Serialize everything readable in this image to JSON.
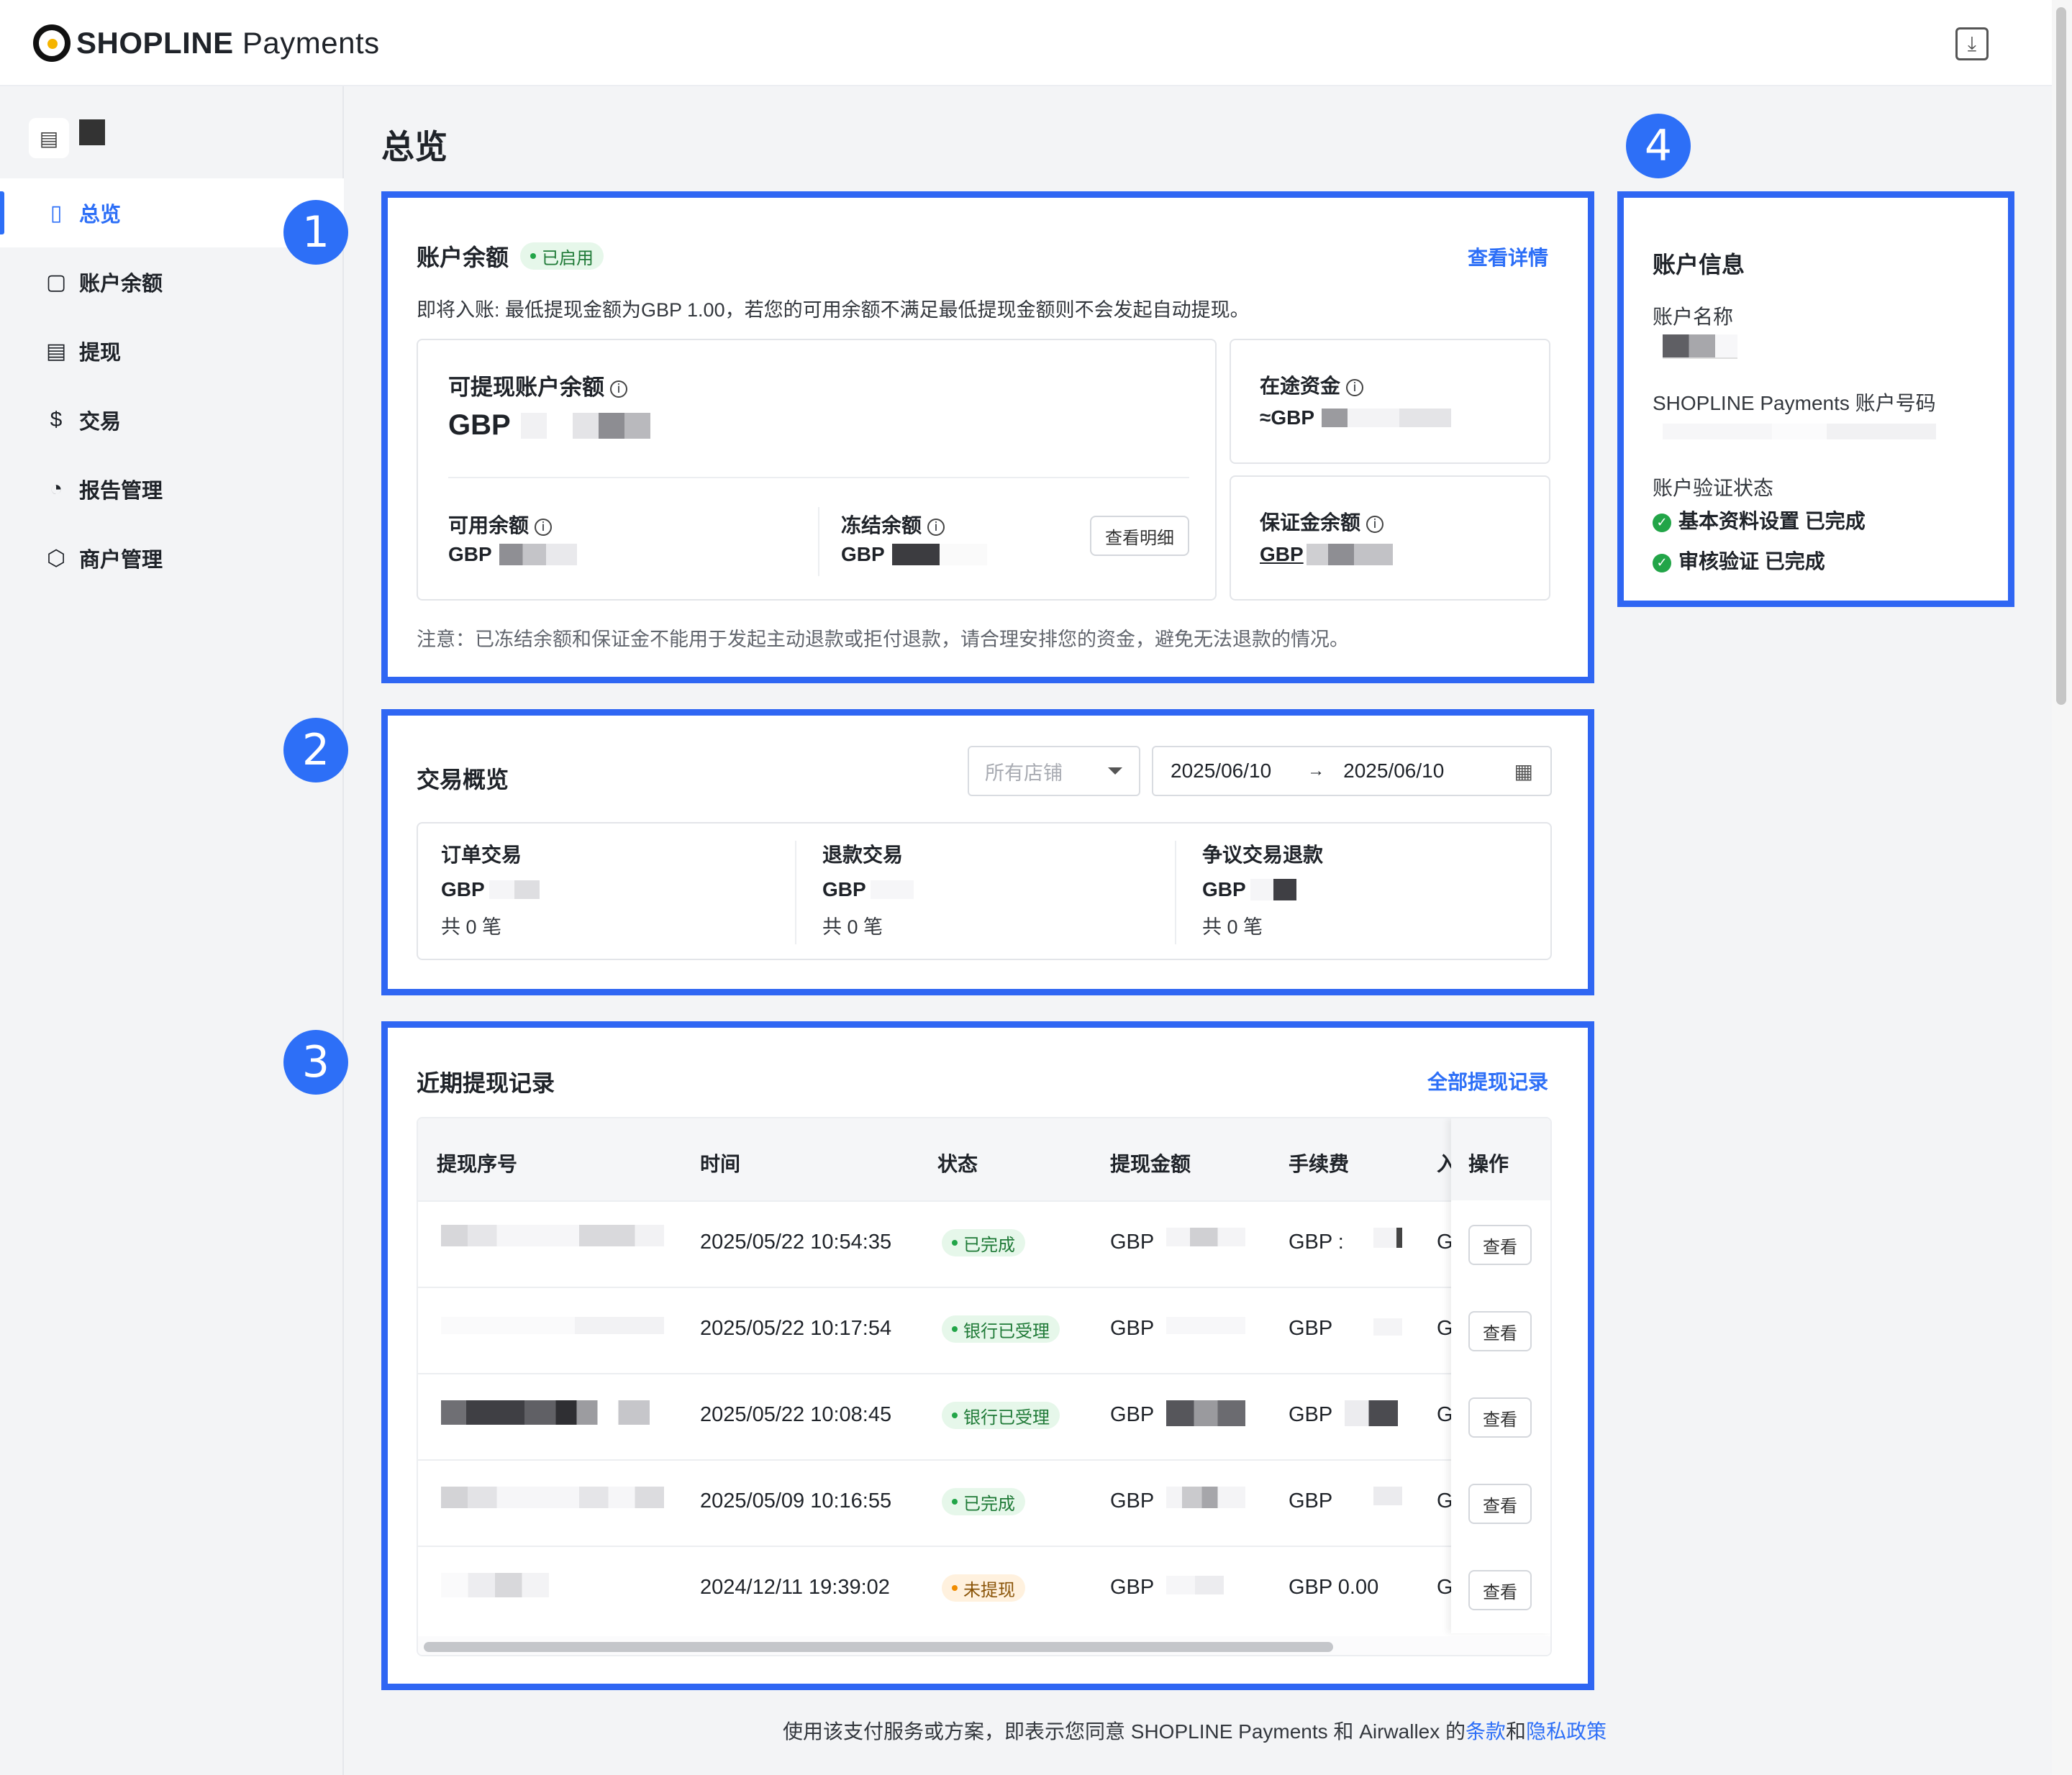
{
  "brand": {
    "logo_bold": "SHOPLINE",
    "logo_light": "Payments"
  },
  "sidebar": {
    "items": [
      {
        "label": "总览",
        "icon": "dashboard-icon",
        "glyph": "▯"
      },
      {
        "label": "账户余额",
        "icon": "wallet-icon",
        "glyph": "▢"
      },
      {
        "label": "提现",
        "icon": "withdraw-icon",
        "glyph": "▤"
      },
      {
        "label": "交易",
        "icon": "transaction-icon",
        "glyph": "$"
      },
      {
        "label": "报告管理",
        "icon": "report-icon",
        "glyph": "◔"
      },
      {
        "label": "商户管理",
        "icon": "merchant-icon",
        "glyph": "⬡"
      }
    ]
  },
  "page": {
    "title": "总览"
  },
  "balance": {
    "title": "账户余额",
    "status": "已启用",
    "detail_link": "查看详情",
    "notice": "即将入账: 最低提现金额为GBP 1.00，若您的可用余额不满足最低提现金额则不会发起自动提现。",
    "withdrawable_label": "可提现账户余额",
    "withdrawable_currency": "GBP",
    "available_label": "可用余额",
    "available_currency": "GBP",
    "frozen_label": "冻结余额",
    "frozen_currency": "GBP",
    "view_breakdown": "查看明细",
    "in_transit_label": "在途资金",
    "in_transit_currency": "≈GBP",
    "deposit_label": "保证金余额",
    "deposit_currency": "GBP",
    "note": "注意：已冻结余额和保证金不能用于发起主动退款或拒付退款，请合理安排您的资金，避免无法退款的情况。"
  },
  "transactions": {
    "title": "交易概览",
    "store_placeholder": "所有店铺",
    "date_from": "2025/06/10",
    "date_to": "2025/06/10",
    "arrow": "→",
    "stats": [
      {
        "label": "订单交易",
        "currency": "GBP",
        "count": "共 0 笔"
      },
      {
        "label": "退款交易",
        "currency": "GBP",
        "count": "共 0 笔"
      },
      {
        "label": "争议交易退款",
        "currency": "GBP",
        "count": "共 0 笔"
      }
    ]
  },
  "withdrawals": {
    "title": "近期提现记录",
    "all_link": "全部提现记录",
    "columns": [
      "提现序号",
      "时间",
      "状态",
      "提现金额",
      "手续费",
      "入",
      "操作"
    ],
    "rows": [
      {
        "time": "2025/05/22 10:54:35",
        "status": "已完成",
        "status_type": "green",
        "amount": "GBP",
        "fee": "GBP :",
        "extra": "G",
        "action": "查看"
      },
      {
        "time": "2025/05/22 10:17:54",
        "status": "银行已受理",
        "status_type": "green",
        "amount": "GBP",
        "fee": "GBP",
        "extra": "G",
        "action": "查看"
      },
      {
        "time": "2025/05/22 10:08:45",
        "status": "银行已受理",
        "status_type": "green",
        "amount": "GBP",
        "fee": "GBP",
        "extra": "G",
        "action": "查看"
      },
      {
        "time": "2025/05/09 10:16:55",
        "status": "已完成",
        "status_type": "green",
        "amount": "GBP",
        "fee": "GBP",
        "extra": "G",
        "action": "查看"
      },
      {
        "time": "2024/12/11 19:39:02",
        "status": "未提现",
        "status_type": "orange",
        "amount": "GBP",
        "fee": "GBP 0.00",
        "extra": "G",
        "action": "查看"
      }
    ]
  },
  "account_info": {
    "title": "账户信息",
    "name_label": "账户名称",
    "number_label": "SHOPLINE Payments 账户号码",
    "verify_label": "账户验证状态",
    "verify_items": [
      {
        "label": "基本资料设置 已完成"
      },
      {
        "label": "审核验证 已完成"
      }
    ]
  },
  "annotations": [
    "1",
    "2",
    "3",
    "4"
  ],
  "footer": {
    "text": "使用该支付服务或方案，即表示您同意 SHOPLINE Payments 和 Airwallex 的",
    "terms": "条款",
    "and": "和",
    "privacy": "隐私政策"
  },
  "colors": {
    "accent": "#2d6ff7",
    "frame": "#2f66f3",
    "success": "#22a548",
    "warning": "#f08c00"
  }
}
